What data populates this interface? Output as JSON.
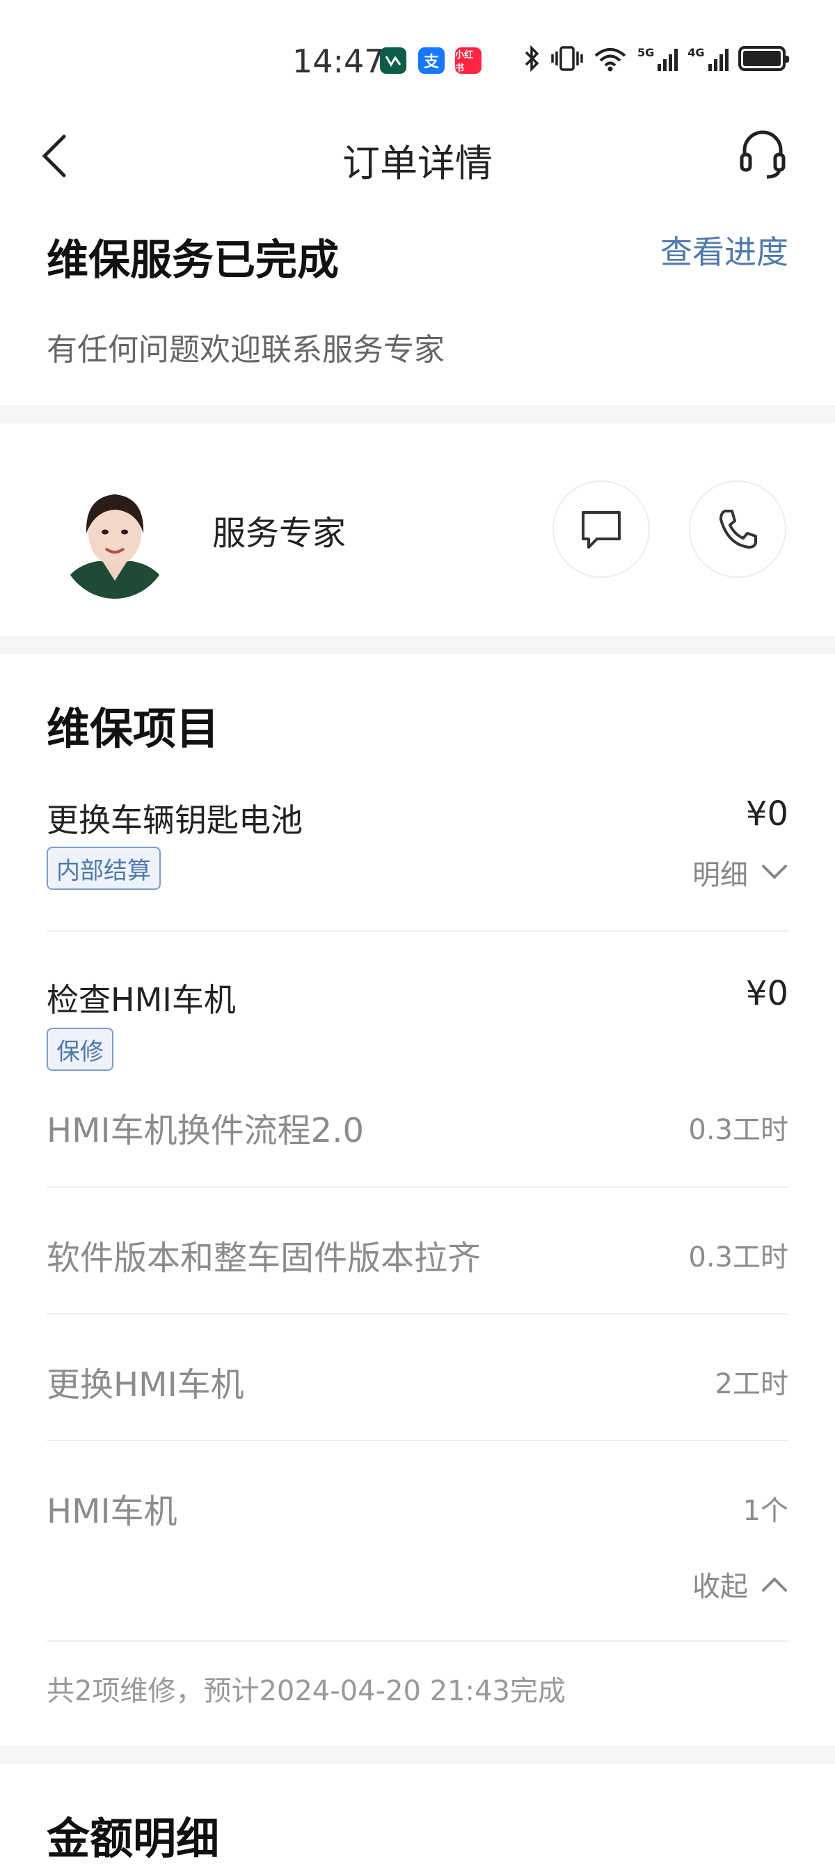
{
  "status_bar": {
    "time": "14:47",
    "apps": [
      {
        "icon": "app-green-icon",
        "label": "",
        "color": "#0d5c4a"
      },
      {
        "icon": "alipay-icon",
        "label": "支",
        "color": "#1677ff"
      },
      {
        "icon": "xiaohongshu-icon",
        "label": "小红书",
        "color": "#ff2442"
      }
    ],
    "network_5g": "5G",
    "network_4g": "4G"
  },
  "nav": {
    "title": "订单详情"
  },
  "order": {
    "status": "维保服务已完成",
    "progress_link": "查看进度",
    "subtitle": "有任何问题欢迎联系服务专家"
  },
  "expert": {
    "label": "服务专家"
  },
  "maintenance": {
    "title": "维保项目",
    "items": [
      {
        "name": "更换车辆钥匙电池",
        "price": "¥0",
        "tag": "内部结算",
        "toggle": "明细"
      },
      {
        "name": "检查HMI车机",
        "price": "¥0",
        "tag": "保修"
      }
    ],
    "details": [
      {
        "name": "HMI车机换件流程2.0",
        "qty": "0.3工时"
      },
      {
        "name": "软件版本和整车固件版本拉齐",
        "qty": "0.3工时"
      },
      {
        "name": "更换HMI车机",
        "qty": "2工时"
      },
      {
        "name": "HMI车机",
        "qty": "1个"
      }
    ],
    "collapse": "收起",
    "summary": "共2项维修，预计2024-04-20 21:43完成"
  },
  "amount": {
    "title": "金额明细"
  },
  "colors": {
    "accent": "#4f79a9",
    "tag_border": "#7b9ec9"
  }
}
